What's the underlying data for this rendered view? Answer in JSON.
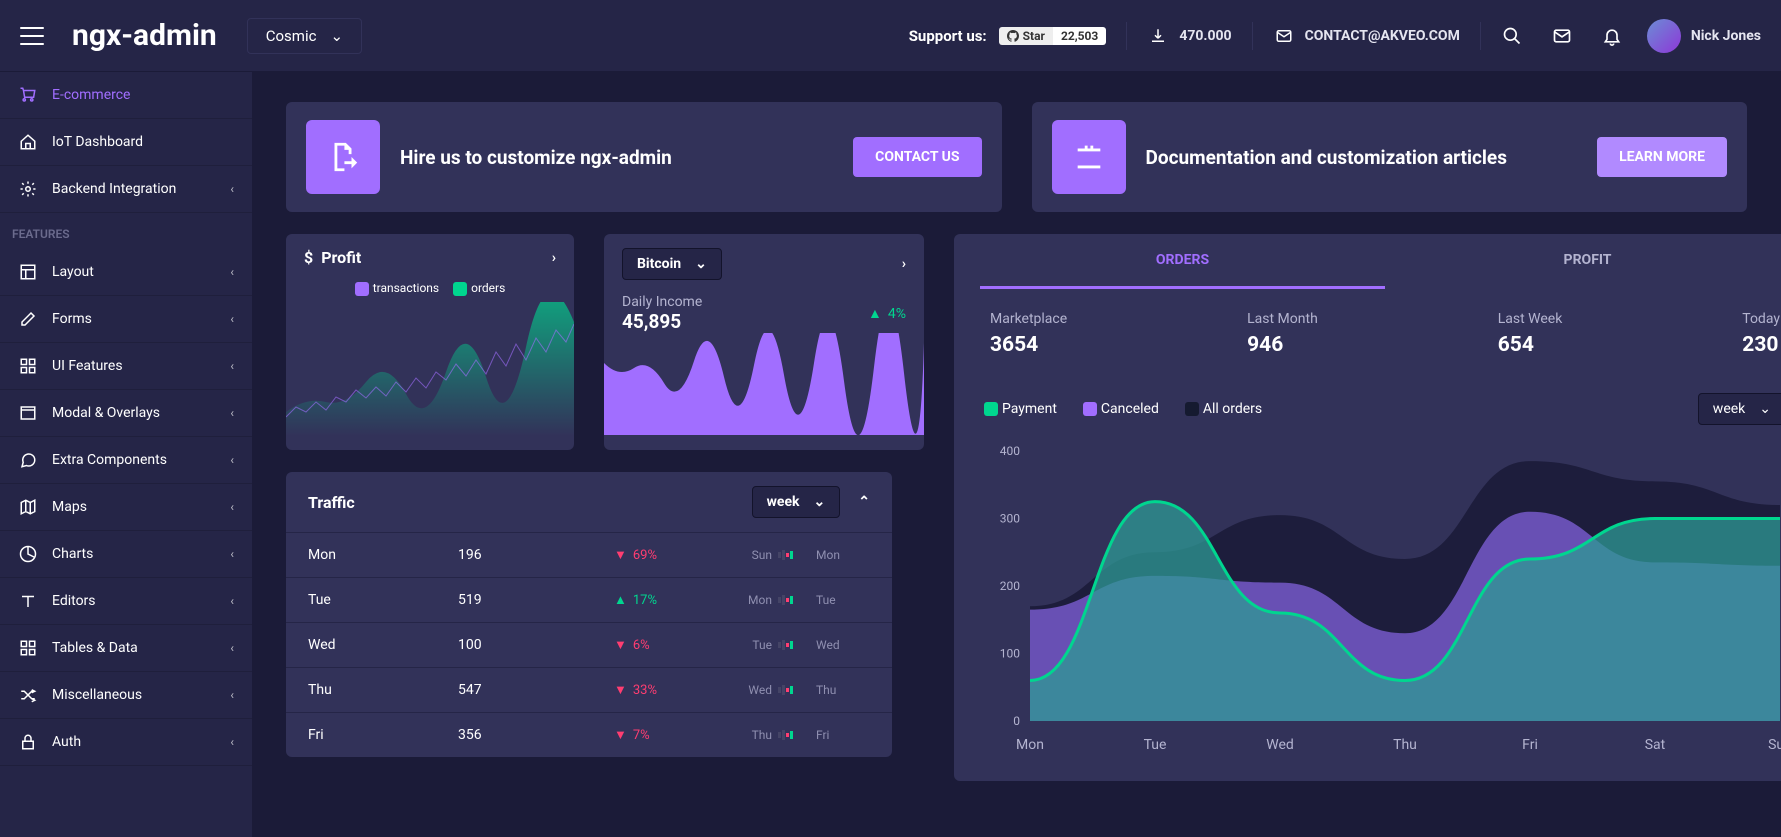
{
  "header": {
    "logo": "ngx-admin",
    "theme": "Cosmic",
    "support_label": "Support us:",
    "gh_star": "Star",
    "gh_count": "22,503",
    "downloads": "470.000",
    "contact": "CONTACT@AKVEO.COM",
    "user": "Nick Jones"
  },
  "sidebar": {
    "items1": [
      {
        "label": "E-commerce",
        "icon": "cart",
        "active": true
      },
      {
        "label": "IoT Dashboard",
        "icon": "home"
      },
      {
        "label": "Backend Integration",
        "icon": "gear",
        "expand": true
      }
    ],
    "group": "FEATURES",
    "items2": [
      {
        "label": "Layout",
        "icon": "layout"
      },
      {
        "label": "Forms",
        "icon": "edit"
      },
      {
        "label": "UI Features",
        "icon": "grid"
      },
      {
        "label": "Modal & Overlays",
        "icon": "browser"
      },
      {
        "label": "Extra Components",
        "icon": "msg"
      },
      {
        "label": "Maps",
        "icon": "map"
      },
      {
        "label": "Charts",
        "icon": "pie"
      },
      {
        "label": "Editors",
        "icon": "text"
      },
      {
        "label": "Tables & Data",
        "icon": "table"
      },
      {
        "label": "Miscellaneous",
        "icon": "shuffle"
      },
      {
        "label": "Auth",
        "icon": "lock"
      }
    ]
  },
  "cta1": {
    "text": "Hire us to customize ngx-admin",
    "btn": "CONTACT US"
  },
  "cta2": {
    "text": "Documentation and customization articles",
    "btn": "LEARN MORE"
  },
  "profit": {
    "title": "Profit",
    "legend1": "transactions",
    "legend2": "orders"
  },
  "bitcoin": {
    "select": "Bitcoin",
    "income_label": "Daily Income",
    "income_val": "45,895",
    "pct": "4%"
  },
  "traffic": {
    "title": "Traffic",
    "period": "week",
    "rows": [
      {
        "day": "Mon",
        "val": "196",
        "dir": "down",
        "pct": "69%",
        "prev": "Sun",
        "cur": "Mon"
      },
      {
        "day": "Tue",
        "val": "519",
        "dir": "up",
        "pct": "17%",
        "prev": "Mon",
        "cur": "Tue"
      },
      {
        "day": "Wed",
        "val": "100",
        "dir": "down",
        "pct": "6%",
        "prev": "Tue",
        "cur": "Wed"
      },
      {
        "day": "Thu",
        "val": "547",
        "dir": "down",
        "pct": "33%",
        "prev": "Wed",
        "cur": "Thu"
      },
      {
        "day": "Fri",
        "val": "356",
        "dir": "down",
        "pct": "7%",
        "prev": "Thu",
        "cur": "Fri"
      }
    ]
  },
  "orders": {
    "tab1": "ORDERS",
    "tab2": "PROFIT",
    "metrics": [
      {
        "label": "Marketplace",
        "val": "3654"
      },
      {
        "label": "Last Month",
        "val": "946"
      },
      {
        "label": "Last Week",
        "val": "654"
      },
      {
        "label": "Today",
        "val": "230"
      }
    ],
    "legend": [
      "Payment",
      "Canceled",
      "All orders"
    ],
    "period": "week"
  },
  "chart_data": {
    "type": "area",
    "categories": [
      "Mon",
      "Tue",
      "Wed",
      "Thu",
      "Fri",
      "Sat",
      "Sun"
    ],
    "series": [
      {
        "name": "Payment",
        "values": [
          60,
          325,
          160,
          60,
          240,
          300,
          300
        ]
      },
      {
        "name": "Canceled",
        "values": [
          165,
          215,
          205,
          130,
          310,
          235,
          230
        ]
      },
      {
        "name": "All orders",
        "values": [
          170,
          250,
          305,
          240,
          385,
          355,
          320
        ]
      }
    ],
    "ylim": [
      0,
      400
    ],
    "yticks": [
      0,
      100,
      200,
      300,
      400
    ],
    "xlabel": "",
    "ylabel": "",
    "title": ""
  }
}
